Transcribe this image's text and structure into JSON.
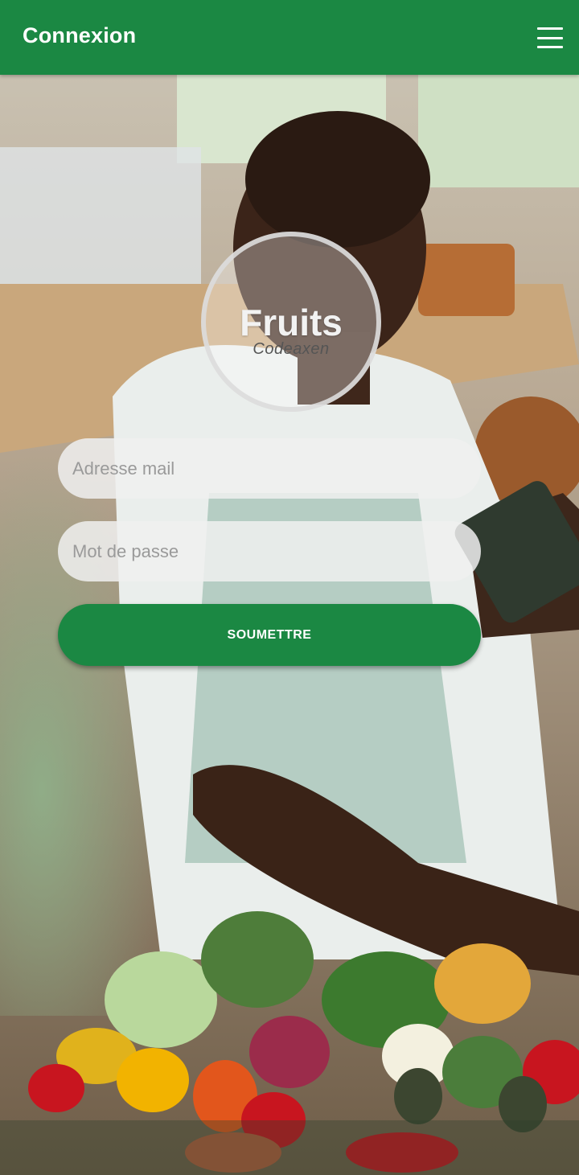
{
  "header": {
    "title": "Connexion",
    "menu_icon": "hamburger-menu-icon"
  },
  "logo": {
    "title": "Fruits",
    "subtitle": "Codeaxen"
  },
  "form": {
    "email_placeholder": "Adresse mail",
    "password_placeholder": "Mot de passe",
    "submit_label": "SOUMETTRE"
  },
  "colors": {
    "primary": "#1b8843",
    "header_text": "#ffffff"
  }
}
